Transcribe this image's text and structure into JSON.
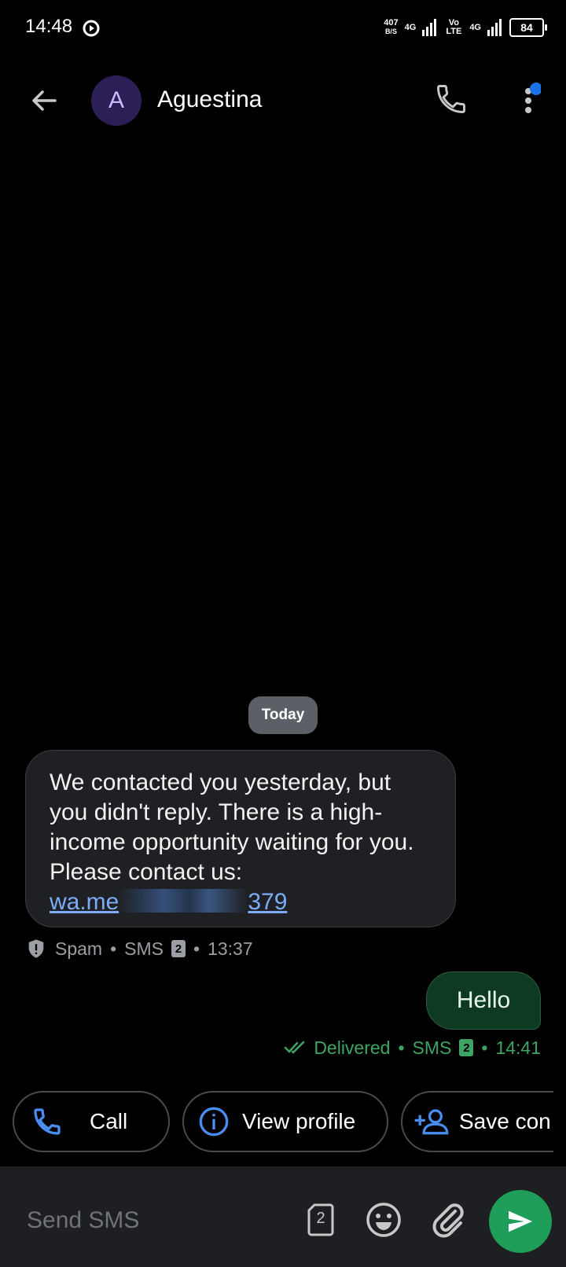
{
  "status_bar": {
    "time": "14:48",
    "net_speed_value": "407",
    "net_speed_unit": "B/S",
    "net_type_1": "4G",
    "volte": "Vo LTE",
    "net_type_2": "4G",
    "battery": "84"
  },
  "header": {
    "avatar_letter": "A",
    "contact_name": "Aguestina",
    "call_icon": "phone-icon",
    "more_icon": "more-vertical-icon",
    "notification_dot_color": "#1a73e8"
  },
  "conversation": {
    "date_chip": "Today",
    "incoming": {
      "text": "We contacted you yesterday, but you didn't reply. There is a high-income opportunity waiting for you. Please contact us:",
      "link_prefix": "wa.me",
      "link_suffix": "379",
      "meta_label": "Spam",
      "meta_channel": "SMS",
      "meta_sim": "2",
      "meta_time": "13:37"
    },
    "outgoing": {
      "text": "Hello",
      "status": "Delivered",
      "channel": "SMS",
      "sim": "2",
      "time": "14:41"
    }
  },
  "suggestions": {
    "call_label": "Call",
    "view_profile_label": "View profile",
    "save_contact_label": "Save con"
  },
  "composer": {
    "placeholder": "Send SMS",
    "sim_number": "2",
    "send_color": "#1e9e58"
  }
}
